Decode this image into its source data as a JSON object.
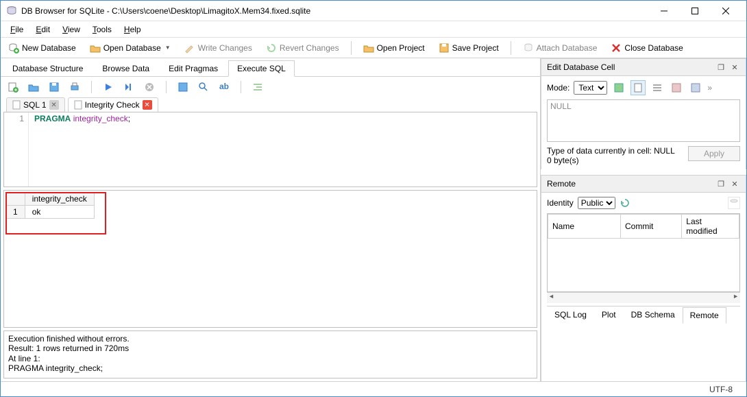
{
  "window": {
    "title": "DB Browser for SQLite - C:\\Users\\coene\\Desktop\\LimagitoX.Mem34.fixed.sqlite"
  },
  "menu": {
    "file": "File",
    "edit": "Edit",
    "view": "View",
    "tools": "Tools",
    "help": "Help"
  },
  "toolbar": {
    "new_db": "New Database",
    "open_db": "Open Database",
    "write_changes": "Write Changes",
    "revert_changes": "Revert Changes",
    "open_project": "Open Project",
    "save_project": "Save Project",
    "attach_db": "Attach Database",
    "close_db": "Close Database"
  },
  "main_tabs": {
    "db_structure": "Database Structure",
    "browse_data": "Browse Data",
    "edit_pragmas": "Edit Pragmas",
    "execute_sql": "Execute SQL"
  },
  "editor_tabs": {
    "sql1": "SQL 1",
    "integrity": "Integrity Check"
  },
  "sql": {
    "line_no": "1",
    "keyword": "PRAGMA",
    "identifier": "integrity_check",
    "semicolon": ";"
  },
  "result": {
    "col1": "integrity_check",
    "row1_num": "1",
    "row1_val": "ok"
  },
  "log": {
    "l1": "Execution finished without errors.",
    "l2": "Result: 1 rows returned in 720ms",
    "l3": "At line 1:",
    "l4": "PRAGMA integrity_check;"
  },
  "edit_cell": {
    "title": "Edit Database Cell",
    "mode_label": "Mode:",
    "mode_value": "Text",
    "null_text": "NULL",
    "type_info": "Type of data currently in cell: NULL",
    "size_info": "0 byte(s)",
    "apply": "Apply"
  },
  "remote": {
    "title": "Remote",
    "identity_label": "Identity",
    "identity_value": "Public",
    "col_name": "Name",
    "col_commit": "Commit",
    "col_modified": "Last modified"
  },
  "bottom_tabs": {
    "sql_log": "SQL Log",
    "plot": "Plot",
    "db_schema": "DB Schema",
    "remote": "Remote"
  },
  "status": {
    "encoding": "UTF-8"
  }
}
